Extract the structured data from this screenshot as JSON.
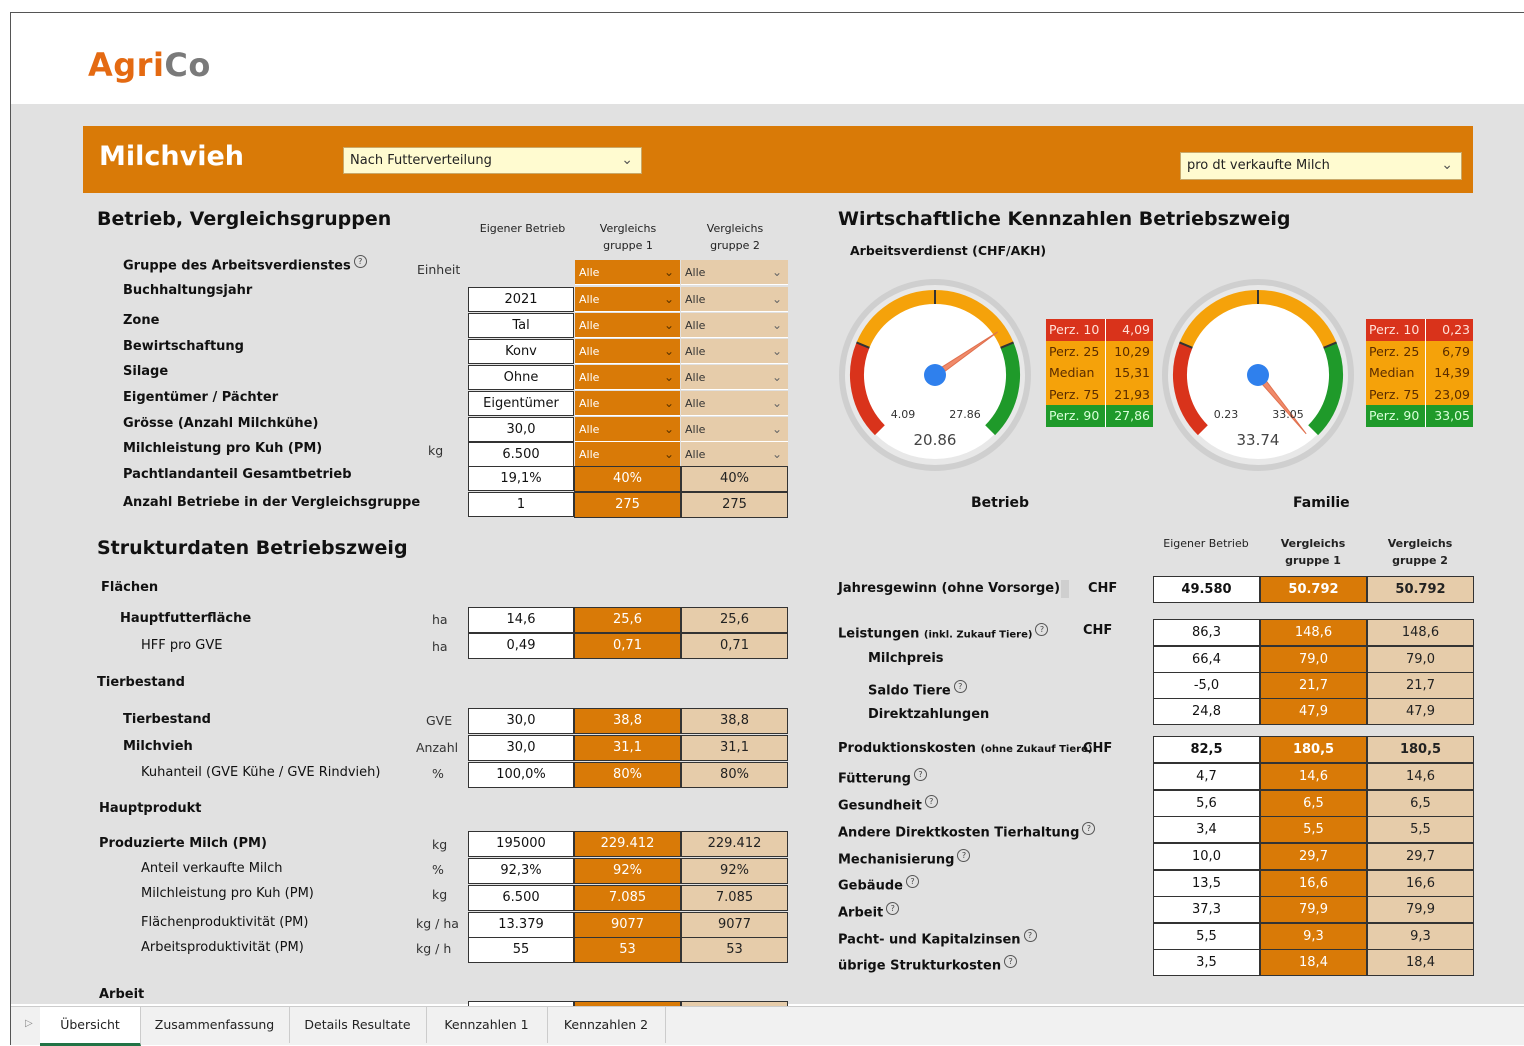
{
  "app": {
    "logo_prefix": "Agri",
    "logo_suffix": "Co"
  },
  "banner": {
    "title": "Milchvieh",
    "dropdown_left": "Nach Futterverteilung",
    "dropdown_right": "pro dt verkaufte Milch"
  },
  "betrieb": {
    "heading": "Betrieb, Vergleichsgruppen",
    "col_own": "Eigener Betrieb",
    "col_g1_a": "Vergleichs",
    "col_g1_b": "gruppe 1",
    "col_g2_a": "Vergleichs",
    "col_g2_b": "gruppe 2",
    "einheit": "Einheit",
    "rows": [
      {
        "label": "Gruppe des Arbeitsverdienstes",
        "unit": "",
        "own": "",
        "g1": "Alle",
        "g2": "Alle"
      },
      {
        "label": "Buchhaltungsjahr",
        "unit": "",
        "own": "2021",
        "g1": "Alle",
        "g2": "Alle"
      },
      {
        "label": "Zone",
        "unit": "",
        "own": "Tal",
        "g1": "Alle",
        "g2": "Alle"
      },
      {
        "label": "Bewirtschaftung",
        "unit": "",
        "own": "Konv",
        "g1": "Alle",
        "g2": "Alle"
      },
      {
        "label": "Silage",
        "unit": "",
        "own": "Ohne",
        "g1": "Alle",
        "g2": "Alle"
      },
      {
        "label": "Eigentümer / Pächter",
        "unit": "",
        "own": "Eigentümer",
        "g1": "Alle",
        "g2": "Alle"
      },
      {
        "label": "Grösse (Anzahl Milchkühe)",
        "unit": "",
        "own": "30,0",
        "g1": "Alle",
        "g2": "Alle"
      },
      {
        "label": "Milchleistung pro Kuh (PM)",
        "unit": "kg",
        "own": "6.500",
        "g1": "Alle",
        "g2": "Alle"
      },
      {
        "label": "Pachtlandanteil Gesamtbetrieb",
        "unit": "",
        "own": "19,1%",
        "g1": "40%",
        "g2": "40%"
      },
      {
        "label": "Anzahl Betriebe in der Vergleichsgruppe",
        "unit": "",
        "own": "1",
        "g1": "275",
        "g2": "275"
      }
    ]
  },
  "struktur": {
    "heading": "Strukturdaten Betriebszweig",
    "flaechen": "Flächen",
    "hff_label": "Hauptfutterfläche",
    "hff_unit": "ha",
    "hff": [
      "14,6",
      "25,6",
      "25,6"
    ],
    "hffgve_label": "HFF pro GVE",
    "hffgve_unit": "ha",
    "hffgve": [
      "0,49",
      "0,71",
      "0,71"
    ],
    "tierbestand_head": "Tierbestand",
    "tier_label": "Tierbestand",
    "tier_unit": "GVE",
    "tier": [
      "30,0",
      "38,8",
      "38,8"
    ],
    "milch_label": "Milchvieh",
    "milch_unit": "Anzahl",
    "milch": [
      "30,0",
      "31,1",
      "31,1"
    ],
    "kuh_label": "Kuhanteil (GVE Kühe / GVE Rindvieh)",
    "kuh_unit": "%",
    "kuh": [
      "100,0%",
      "80%",
      "80%"
    ],
    "hauptprodukt": "Hauptprodukt",
    "prod_label": "Produzierte Milch (PM)",
    "prod_unit": "kg",
    "prod": [
      "195000",
      "229.412",
      "229.412"
    ],
    "anteil_label": "Anteil verkaufte Milch",
    "anteil_unit": "%",
    "anteil": [
      "92,3%",
      "92%",
      "92%"
    ],
    "ml_label": "Milchleistung pro Kuh (PM)",
    "ml_unit": "kg",
    "ml": [
      "6.500",
      "7.085",
      "7.085"
    ],
    "fp_label": "Flächenproduktivität (PM)",
    "fp_unit": "kg / ha",
    "fp": [
      "13.379",
      "9077",
      "9077"
    ],
    "ap_label": "Arbeitsproduktivität (PM)",
    "ap_unit": "kg / h",
    "ap": [
      "55",
      "53",
      "53"
    ],
    "arbeit": "Arbeit"
  },
  "wirtschaft": {
    "heading": "Wirtschaftliche Kennzahlen Betriebszweig",
    "subheading": "Arbeitsverdienst (CHF/AKH)",
    "gauge1": {
      "title": "Betrieb",
      "value": "20.86",
      "min_label": "4.09",
      "max_label": "27.86",
      "value_num": 20.86,
      "min": 4.09,
      "max": 27.86
    },
    "gauge2": {
      "title": "Familie",
      "value": "33.74",
      "min_label": "0.23",
      "max_label": "33.05",
      "value_num": 33.74,
      "min": 0.23,
      "max": 33.05
    },
    "perc1": [
      [
        "Perz. 10",
        "4,09"
      ],
      [
        "Perz. 25",
        "10,29"
      ],
      [
        "Median",
        "15,31"
      ],
      [
        "Perz. 75",
        "21,93"
      ],
      [
        "Perz. 90",
        "27,86"
      ]
    ],
    "perc2": [
      [
        "Perz. 10",
        "0,23"
      ],
      [
        "Perz. 25",
        "6,79"
      ],
      [
        "Median",
        "14,39"
      ],
      [
        "Perz. 75",
        "23,09"
      ],
      [
        "Perz. 90",
        "33,05"
      ]
    ],
    "colors": {
      "red": "#d9331b",
      "orange": "#f5a20a",
      "green": "#1f9a2a"
    },
    "col_own": "Eigener Betrieb",
    "col_g1_a": "Vergleichs",
    "col_g1_b": "gruppe 1",
    "col_g2_a": "Vergleichs",
    "col_g2_b": "gruppe 2",
    "jahresgewinn": {
      "label": "Jahresgewinn (ohne Vorsorge)",
      "unit": "CHF",
      "vals": [
        "49.580",
        "50.792",
        "50.792"
      ]
    },
    "leistungen": {
      "label": "Leistungen",
      "sub": "(inkl. Zukauf Tiere)",
      "unit": "CHF",
      "vals": [
        "86,3",
        "148,6",
        "148,6"
      ]
    },
    "milchpreis": {
      "label": "Milchpreis",
      "vals": [
        "66,4",
        "79,0",
        "79,0"
      ]
    },
    "saldo": {
      "label": "Saldo Tiere",
      "vals": [
        "-5,0",
        "21,7",
        "21,7"
      ]
    },
    "direkt": {
      "label": "Direktzahlungen",
      "vals": [
        "24,8",
        "47,9",
        "47,9"
      ]
    },
    "prodkosten": {
      "label": "Produktionskosten",
      "sub": "(ohne Zukauf Tiere)",
      "unit": "CHF",
      "vals": [
        "82,5",
        "180,5",
        "180,5"
      ]
    },
    "kosten": [
      {
        "label": "Fütterung",
        "vals": [
          "4,7",
          "14,6",
          "14,6"
        ]
      },
      {
        "label": "Gesundheit",
        "vals": [
          "5,6",
          "6,5",
          "6,5"
        ]
      },
      {
        "label": "Andere Direktkosten Tierhaltung",
        "vals": [
          "3,4",
          "5,5",
          "5,5"
        ]
      },
      {
        "label": "Mechanisierung",
        "vals": [
          "10,0",
          "29,7",
          "29,7"
        ]
      },
      {
        "label": "Gebäude",
        "vals": [
          "13,5",
          "16,6",
          "16,6"
        ]
      },
      {
        "label": "Arbeit",
        "vals": [
          "37,3",
          "79,9",
          "79,9"
        ]
      },
      {
        "label": "Pacht- und Kapitalzinsen",
        "vals": [
          "5,5",
          "9,3",
          "9,3"
        ]
      },
      {
        "label": "übrige Strukturkosten",
        "vals": [
          "3,5",
          "18,4",
          "18,4"
        ]
      }
    ]
  },
  "tabs": [
    "Übersicht",
    "Zusammenfassung",
    "Details Resultate",
    "Kennzahlen 1",
    "Kennzahlen 2"
  ],
  "help_glyph": "?"
}
